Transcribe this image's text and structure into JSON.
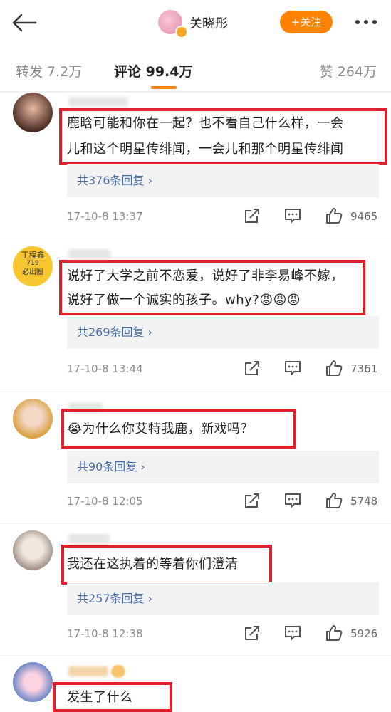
{
  "header": {
    "page_name": "关晓彤",
    "follow_label": "+关注"
  },
  "tabs": {
    "repost": "转发 7.2万",
    "comment": "评论 99.4万",
    "like": "赞 264万"
  },
  "avatars": {
    "c2_text_line1": "丁程鑫",
    "c2_text_line2": "719",
    "c2_text_line3": "必出圈"
  },
  "comments": [
    {
      "text_line1": "鹿晗可能和你在一起？也不看自己什么样，一会",
      "text_line2": "儿和这个明星传绯闻，一会儿和那个明星传绯闻",
      "reply_label": "共376条回复 ›",
      "time": "17-10-8 13:37",
      "likes": "9465"
    },
    {
      "text_line1": "说好了大学之前不恋爱，说好了非李易峰不嫁，",
      "text_line2": "说好了做一个诚实的孩子。why?😡😡😡",
      "reply_label": "共269条回复 ›",
      "time": "17-10-8 13:44",
      "likes": "7361"
    },
    {
      "text_line1": "😭为什么你艾特我鹿，新戏吗？",
      "reply_label": "共90条回复 ›",
      "time": "17-10-8 12:05",
      "likes": "5748"
    },
    {
      "text_line1": "我还在这执着的等着你们澄清",
      "reply_label": "共257条回复 ›",
      "time": "17-10-8 12:38",
      "likes": "5926"
    },
    {
      "text_line1": "发生了什么"
    }
  ],
  "colors": {
    "accent": "#ff8200",
    "highlight": "#e0202c",
    "link": "#4a6ea9"
  },
  "icons": [
    "back-arrow-icon",
    "more-dots-icon",
    "share-icon",
    "comment-icon",
    "thumbs-up-icon",
    "verified-badge-icon"
  ]
}
